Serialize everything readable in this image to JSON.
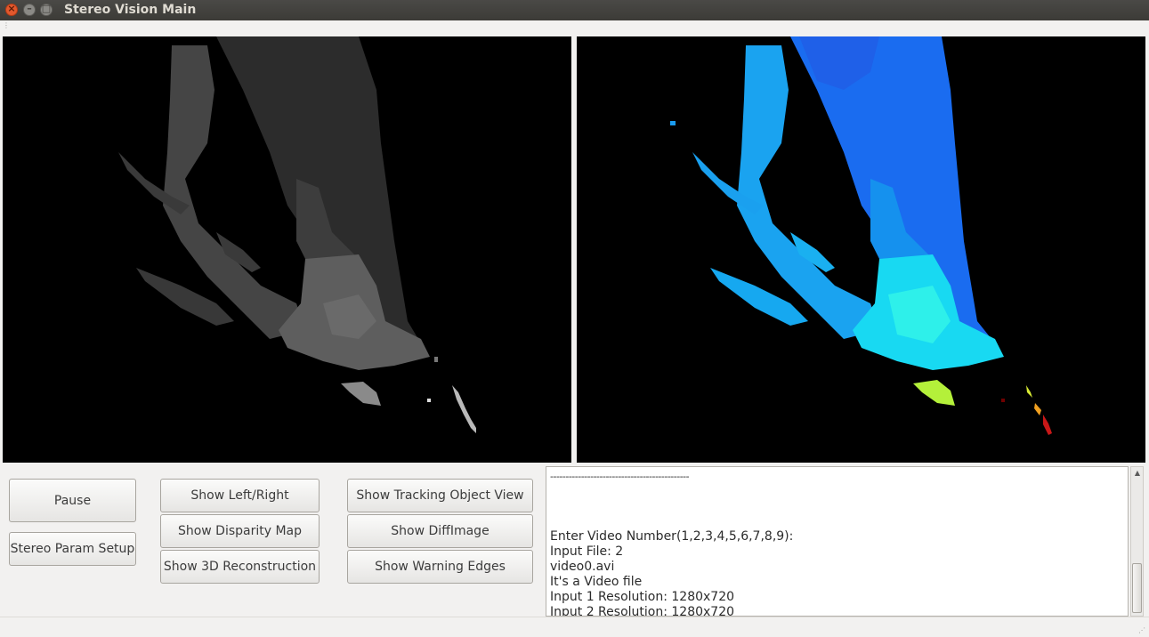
{
  "window": {
    "title": "Stereo Vision Main"
  },
  "panes": {
    "left_view": "disparity-grayscale",
    "right_view": "disparity-colormap"
  },
  "buttons": {
    "pause": "Pause",
    "stereo_param_setup": "Stereo Param Setup",
    "show_left_right": "Show Left/Right",
    "show_disparity_map": "Show Disparity Map",
    "show_3d_reconstruction": "Show 3D Reconstruction",
    "show_tracking_object_view": "Show Tracking Object View",
    "show_diffimage": "Show DiffImage",
    "show_warning_edges": "Show Warning Edges"
  },
  "console": {
    "lines": [
      "---------------------------------------------",
      "",
      "",
      "",
      "Enter Video Number(1,2,3,4,5,6,7,8,9):",
      "Input File: 2",
      "video0.avi",
      "It's a Video file",
      "Input 1 Resolution: 1280x720",
      "Input 2 Resolution: 1280x720"
    ]
  },
  "colors": {
    "title_bar": "#3c3b37",
    "window_bg": "#f2f1f0",
    "close_button": "#e2582d"
  }
}
